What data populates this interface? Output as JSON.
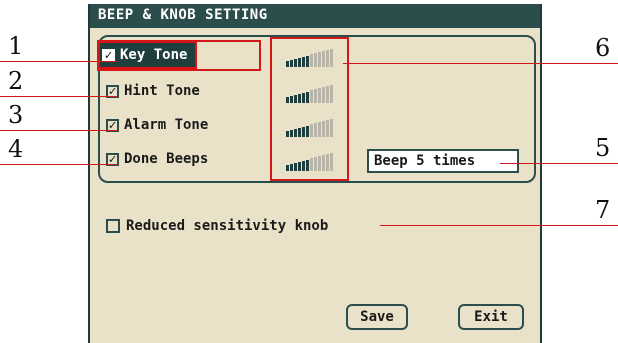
{
  "window": {
    "title": "BEEP & KNOB SETTING"
  },
  "tones": [
    {
      "label": "Key Tone",
      "checked": true,
      "selected": true,
      "volume_level": 0.5
    },
    {
      "label": "Hint Tone",
      "checked": true,
      "selected": false,
      "volume_level": 0.5
    },
    {
      "label": "Alarm Tone",
      "checked": true,
      "selected": false,
      "volume_level": 0.5
    },
    {
      "label": "Done Beeps",
      "checked": true,
      "selected": false,
      "volume_level": 0.5
    }
  ],
  "beep_count": {
    "value": "Beep 5 times"
  },
  "knob": {
    "label": "Reduced sensitivity knob",
    "checked": false
  },
  "buttons": {
    "save": "Save",
    "exit": "Exit"
  },
  "annotations": [
    "1",
    "2",
    "3",
    "4",
    "5",
    "6",
    "7"
  ],
  "colors": {
    "panel_bg": "#e9e1c8",
    "title_bar": "#2b4d4b",
    "annotation_red": "#d21818",
    "bar_filled": "#1f3f3f",
    "bar_empty": "#b8b4a8"
  }
}
